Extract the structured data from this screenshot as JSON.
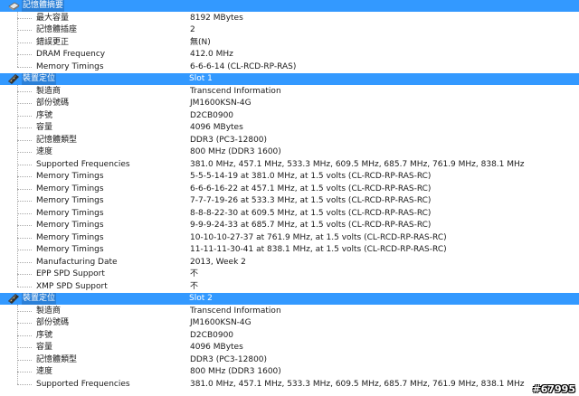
{
  "sections": [
    {
      "header": {
        "label": "記憶體摘要",
        "value": ""
      },
      "icon": "memory-chip-icon",
      "rows": [
        {
          "label": "最大容量",
          "value": "8192 MBytes"
        },
        {
          "label": "記憶體插座",
          "value": "2"
        },
        {
          "label": "錯誤更正",
          "value": "無(N)"
        },
        {
          "label": "DRAM Frequency",
          "value": "412.0 MHz"
        },
        {
          "label": "Memory Timings",
          "value": "6-6-6-14 (CL-RCD-RP-RAS)"
        }
      ]
    },
    {
      "header": {
        "label": "裝置定位",
        "value": "Slot 1"
      },
      "icon": "memory-stick-icon",
      "rows": [
        {
          "label": "製造商",
          "value": "Transcend Information"
        },
        {
          "label": "部份號碼",
          "value": "JM1600KSN-4G"
        },
        {
          "label": "序號",
          "value": "D2CB0900"
        },
        {
          "label": "容量",
          "value": "4096 MBytes"
        },
        {
          "label": "記憶體類型",
          "value": "DDR3 (PC3-12800)"
        },
        {
          "label": "速度",
          "value": "800 MHz (DDR3 1600)"
        },
        {
          "label": "Supported Frequencies",
          "value": "381.0 MHz, 457.1 MHz, 533.3 MHz, 609.5 MHz, 685.7 MHz, 761.9 MHz, 838.1 MHz"
        },
        {
          "label": "Memory Timings",
          "value": "5-5-5-14-19 at 381.0 MHz, at 1.5 volts (CL-RCD-RP-RAS-RC)"
        },
        {
          "label": "Memory Timings",
          "value": "6-6-6-16-22 at 457.1 MHz, at 1.5 volts (CL-RCD-RP-RAS-RC)"
        },
        {
          "label": "Memory Timings",
          "value": "7-7-7-19-26 at 533.3 MHz, at 1.5 volts (CL-RCD-RP-RAS-RC)"
        },
        {
          "label": "Memory Timings",
          "value": "8-8-8-22-30 at 609.5 MHz, at 1.5 volts (CL-RCD-RP-RAS-RC)"
        },
        {
          "label": "Memory Timings",
          "value": "9-9-9-24-33 at 685.7 MHz, at 1.5 volts (CL-RCD-RP-RAS-RC)"
        },
        {
          "label": "Memory Timings",
          "value": "10-10-10-27-37 at 761.9 MHz, at 1.5 volts (CL-RCD-RP-RAS-RC)"
        },
        {
          "label": "Memory Timings",
          "value": "11-11-11-30-41 at 838.1 MHz, at 1.5 volts (CL-RCD-RP-RAS-RC)"
        },
        {
          "label": "Manufacturing Date",
          "value": "2013, Week 2"
        },
        {
          "label": "EPP SPD Support",
          "value": "不"
        },
        {
          "label": "XMP SPD Support",
          "value": "不"
        }
      ]
    },
    {
      "header": {
        "label": "裝置定位",
        "value": "Slot 2"
      },
      "icon": "memory-stick-icon",
      "rows": [
        {
          "label": "製造商",
          "value": "Transcend Information"
        },
        {
          "label": "部份號碼",
          "value": "JM1600KSN-4G"
        },
        {
          "label": "序號",
          "value": "D2CB0900"
        },
        {
          "label": "容量",
          "value": "4096 MBytes"
        },
        {
          "label": "記憶體類型",
          "value": "DDR3 (PC3-12800)"
        },
        {
          "label": "速度",
          "value": "800 MHz (DDR3 1600)"
        },
        {
          "label": "Supported Frequencies",
          "value": "381.0 MHz, 457.1 MHz, 533.3 MHz, 609.5 MHz, 685.7 MHz, 761.9 MHz, 838.1 MHz"
        }
      ]
    }
  ],
  "watermark": "#67995",
  "colors": {
    "header_bg": "#3399ff",
    "header_label_bg": "#2b80d8",
    "header_text": "#ffffff",
    "tree_line": "#a8a8a8"
  }
}
